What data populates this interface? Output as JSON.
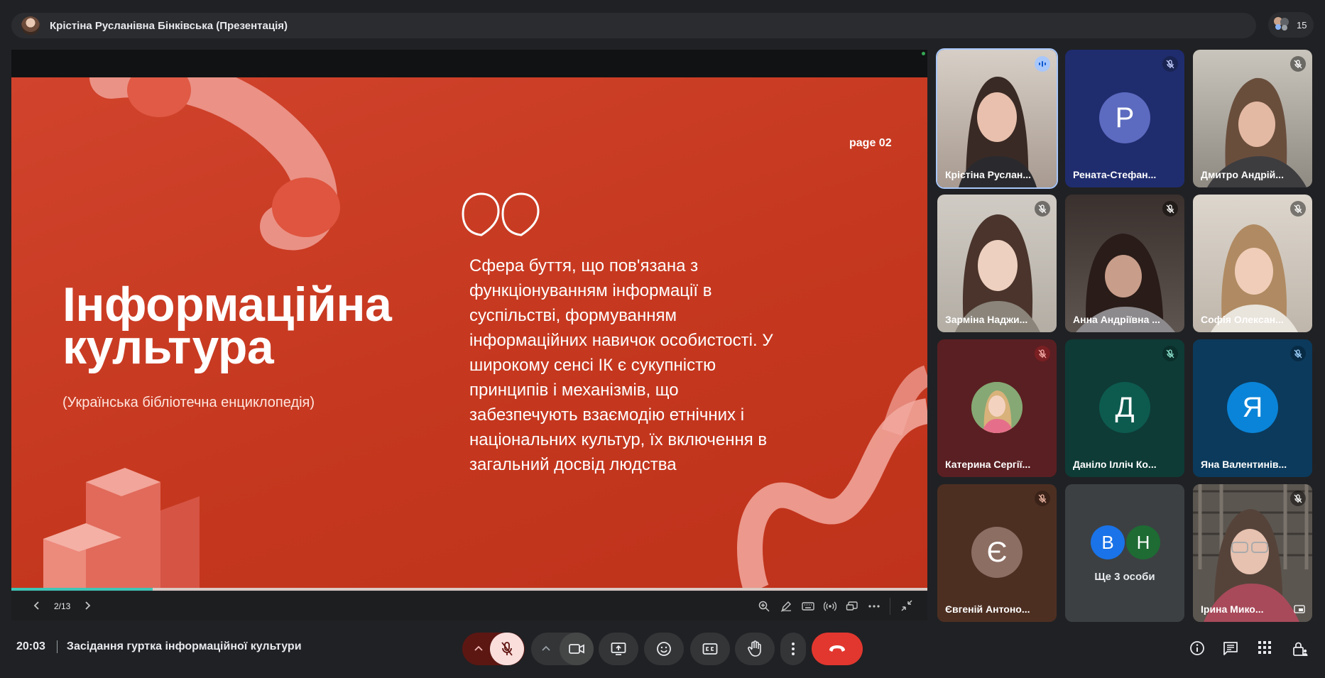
{
  "presenter_bar": {
    "title": "Крістіна Русланівна Бінківська (Презентація)",
    "participant_count": "15"
  },
  "slide": {
    "page_label": "page 02",
    "title_line1": "Інформаційна",
    "title_line2": "культура",
    "source": "(Українська бібліотечна енциклопедія)",
    "quote_lines": [
      "Сфера буття, що пов'язана з",
      "функціонуванням інформації в",
      "суспільстві, формуванням",
      "інформаційних навичок особистості. У",
      "широкому сенсі ІК є сукупністю",
      "принципів і механізмів, що",
      "забезпечують взаємодію етнічних і",
      "національних культур, їх включення в",
      "загальний досвід людства"
    ],
    "pager": "2/13",
    "progress": 0.154
  },
  "participants": [
    {
      "name": "Крістіна Руслан...",
      "tile": "video",
      "speaking": true
    },
    {
      "name": "Рената-Стефан...",
      "tile": "letter",
      "letter": "Р"
    },
    {
      "name": "Дмитро Андрій...",
      "tile": "video"
    },
    {
      "name": "Зарміна Наджи...",
      "tile": "video"
    },
    {
      "name": "Анна Андріївна ...",
      "tile": "video"
    },
    {
      "name": "Софія Олексан...",
      "tile": "video"
    },
    {
      "name": "Катерина Сергії...",
      "tile": "photo"
    },
    {
      "name": "Даніло Ілліч Ко...",
      "tile": "letter",
      "letter": "Д"
    },
    {
      "name": "Яна Валентинів...",
      "tile": "letter",
      "letter": "Я"
    },
    {
      "name": "Євгеній Антоно...",
      "tile": "letter",
      "letter": "Є"
    },
    {
      "name": "",
      "tile": "more",
      "letters": [
        "В",
        "Н"
      ],
      "label": "Ще 3 особи"
    },
    {
      "name": "Ірина Мико...",
      "tile": "video"
    }
  ],
  "bottom_bar": {
    "time": "20:03",
    "meeting_title": "Засідання гуртка інформаційної культури"
  },
  "colors": {
    "slide_bg": "#c83a22",
    "hangup": "#e2372f",
    "mic_off_bg": "#f9dedc",
    "active_ring": "#a8c7fa",
    "accent_teal": "#3fc5b5"
  }
}
